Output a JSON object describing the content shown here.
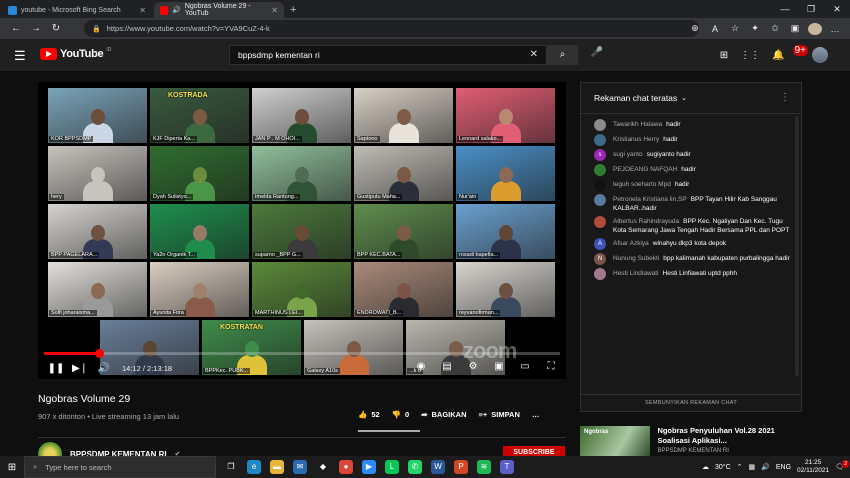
{
  "browser": {
    "tabs": [
      {
        "title": "youtube - Microsoft Bing Search",
        "color": "#2b88d8"
      },
      {
        "title": "Ngobras Volume 29 - YouTub",
        "color": "#ff0000"
      }
    ],
    "new_tab": "+",
    "url": "https://www.youtube.com/watch?v=YVA9CuZ-4-k"
  },
  "youtube": {
    "logo_text": "YouTube",
    "logo_region": "ID",
    "search_value": "bppsdmp kementan ri",
    "notif_count": "9+"
  },
  "video": {
    "tiles": [
      {
        "name": "KOR BPPSDMP",
        "bg": "#7aa3b8",
        "skin": "#6b4d3a",
        "shirt": "#ccd7e6"
      },
      {
        "name": "KJF Diperta Ka...",
        "bg": "#3a5a3e",
        "skin": "#7a5842",
        "shirt": "#3c6a3f"
      },
      {
        "name": "JAN P . M OHOI...",
        "bg": "#cfcfcf",
        "skin": "#6d4c3a",
        "shirt": "#244b2c"
      },
      {
        "name": "Saptono",
        "bg": "#d7d0c4",
        "skin": "#7d5c47",
        "shirt": "#e8e3d9"
      },
      {
        "name": "Leonard salako...",
        "bg": "#e05e73",
        "skin": "#b88870",
        "shirt": "#e05e73"
      },
      {
        "name": "hery",
        "bg": "#c7c4bd",
        "skin": "#c7c4bd",
        "shirt": "#c7c4bd"
      },
      {
        "name": "Dyah Sulistyo...",
        "bg": "#2f6e2f",
        "skin": "#6b8d3f",
        "shirt": "#4b9548"
      },
      {
        "name": "Imelda Rantung...",
        "bg": "#8fbf9a",
        "skin": "#4f6b54",
        "shirt": "#2f5336"
      },
      {
        "name": "Gustiputu Maha...",
        "bg": "#bfbcb4",
        "skin": "#7a5a45",
        "shirt": "#2a2f3a"
      },
      {
        "name": "Nur'ain",
        "bg": "#4a90c7",
        "skin": "#8a6a55",
        "shirt": "#d89d2e"
      },
      {
        "name": "BPP PAGELARA...",
        "bg": "#d6d4cf",
        "skin": "#6e5140",
        "shirt": "#333a55"
      },
      {
        "name": "Ya2n Organik T...",
        "bg": "#1e8f4e",
        "skin": "#9a7a66",
        "shirt": "#1f8c4c"
      },
      {
        "name": "suparno _BPP G...",
        "bg": "#4b7a3b",
        "skin": "#6a4a35",
        "shirt": "#3b3b3b"
      },
      {
        "name": "BPP KEC.BATA...",
        "bg": "#5e8e4d",
        "skin": "#7c5b47",
        "shirt": "#2e4a2a"
      },
      {
        "name": "rosadi bapelta...",
        "bg": "#6aa0cf",
        "skin": "#5f4536",
        "shirt": "#2a3348"
      },
      {
        "name": "Solfi joharaisma...",
        "bg": "#e2e0db",
        "skin": "#8a6a55",
        "shirt": "#9a9a9a"
      },
      {
        "name": "Ayunita Fitra",
        "bg": "#d9cec1",
        "skin": "#a0826d",
        "shirt": "#8a5a4a"
      },
      {
        "name": "MARTHINUS LEI...",
        "bg": "#5a8a3a",
        "skin": "#3f6b2a",
        "shirt": "#7aa44a"
      },
      {
        "name": "ENDROWATI_B...",
        "bg": "#a98a7a",
        "skin": "#7a5545",
        "shirt": "#2a2a30"
      },
      {
        "name": "reyvanofirman...",
        "bg": "#d8d5cf",
        "skin": "#6e5040",
        "shirt": "#3a4a5e"
      },
      {
        "name": "",
        "bg": "#6a7f9a",
        "skin": "#5a4535",
        "shirt": "#2f3a4a"
      },
      {
        "name": "BPPKec. PUBK...",
        "bg": "#3f8c4a",
        "skin": "#3f8c4a",
        "shirt": "#e0c23a"
      },
      {
        "name": "Galaxy A10s",
        "bg": "#c6c2bb",
        "skin": "#7d5a45",
        "shirt": "#c96a3a"
      },
      {
        "name": "...k u",
        "bg": "#b9b6ae",
        "skin": "#7a5d48",
        "shirt": "#3a3a3a"
      }
    ],
    "banner_kostrada_1": "KOSTRADA",
    "banner_kostrada_2": "KOSTRATAN",
    "watermark": "zoom",
    "time_current": "14:12",
    "time_total": "2:13:18",
    "time_sep": " / ",
    "progress": 0.107
  },
  "info": {
    "title": "Ngobras Volume 29",
    "views": "907 x ditonton",
    "meta_sep": " • ",
    "stream": "Live streaming 13 jam lalu",
    "likes": "52",
    "dislikes": "0",
    "share": "BAGIKAN",
    "save": "SIMPAN",
    "channel": "BPPSDMP KEMENTAN RI",
    "subscribe": "SUBSCRIBE"
  },
  "chat": {
    "header": "Rekaman chat teratas",
    "messages": [
      {
        "author": "Tawarikh Halawa",
        "text": "hadir",
        "av": "",
        "color": "#8a8a8a"
      },
      {
        "author": "Kristianus Herry",
        "text": "hadir",
        "av": "",
        "color": "#3a6a8a"
      },
      {
        "author": "sugi yanto",
        "text": "sugiyanto hadir",
        "av": "s",
        "color": "#9c27b0"
      },
      {
        "author": "PEJOEANG NAFQAH",
        "text": "hadir",
        "av": "",
        "color": "#2e7d32"
      },
      {
        "author": "teguh soeharto Mpd",
        "text": "hadir",
        "av": "",
        "color": "#111111"
      },
      {
        "author": "Petronela Kristiana lin,SP",
        "text": "BPP Tayan Hilir Kab Sanggau KALBAR..hadir",
        "av": "",
        "color": "#5a7a9a"
      },
      {
        "author": "Albertus Rahindrayuda",
        "text": "BPP Kec. Ngaliyan Dan Kec. Tugu Kota Semarang Jawa Tengah Hadir Bersama PPL dan POPT",
        "av": "",
        "color": "#b04a3a"
      },
      {
        "author": "Afsar Azkiya",
        "text": "winahyu dkp3 kota depok",
        "av": "A",
        "color": "#3f51b5"
      },
      {
        "author": "Nunung Subekti",
        "text": "bpp kalimanah kabupaten purbalingga hadir",
        "av": "N",
        "color": "#795548"
      },
      {
        "author": "Hesti Lindiawati",
        "text": "Hesti Linfiawati uptd pphh",
        "av": "",
        "color": "#a07a8a"
      }
    ],
    "hide_button": "SEMBUNYIKAN REKAMAN CHAT"
  },
  "recommended": {
    "title": "Ngobras Penyuluhan Vol.28 2021 Soalisasi Aplikasi...",
    "channel": "BPPSDMP KEMENTAN RI",
    "thumb_label": "Ngobras"
  },
  "taskbar": {
    "search_placeholder": "Type here to search",
    "weather": "30°C",
    "lang": "ENG",
    "time": "21:25",
    "date": "02/11/2021",
    "notif": "2",
    "apps": [
      {
        "icon": "task-view-icon",
        "color": "transparent",
        "glyph": "❐"
      },
      {
        "icon": "edge-icon",
        "color": "#1e88c8",
        "glyph": "e"
      },
      {
        "icon": "file-explorer-icon",
        "color": "#e8b43a",
        "glyph": "▬"
      },
      {
        "icon": "mail-icon",
        "color": "#2a6ab0",
        "glyph": "✉"
      },
      {
        "icon": "dropbox-icon",
        "color": "transparent",
        "glyph": "◆"
      },
      {
        "icon": "chrome-icon",
        "color": "#db4437",
        "glyph": "●"
      },
      {
        "icon": "zoom-icon",
        "color": "#2d8cff",
        "glyph": "▶"
      },
      {
        "icon": "line-icon",
        "color": "#06c755",
        "glyph": "L"
      },
      {
        "icon": "whatsapp-icon",
        "color": "#25d366",
        "glyph": "✆"
      },
      {
        "icon": "word-icon",
        "color": "#2b579a",
        "glyph": "W"
      },
      {
        "icon": "powerpoint-icon",
        "color": "#d24726",
        "glyph": "P"
      },
      {
        "icon": "spotify-icon",
        "color": "#1db954",
        "glyph": "≋"
      },
      {
        "icon": "teams-icon",
        "color": "#5b5fc7",
        "glyph": "T"
      }
    ]
  }
}
